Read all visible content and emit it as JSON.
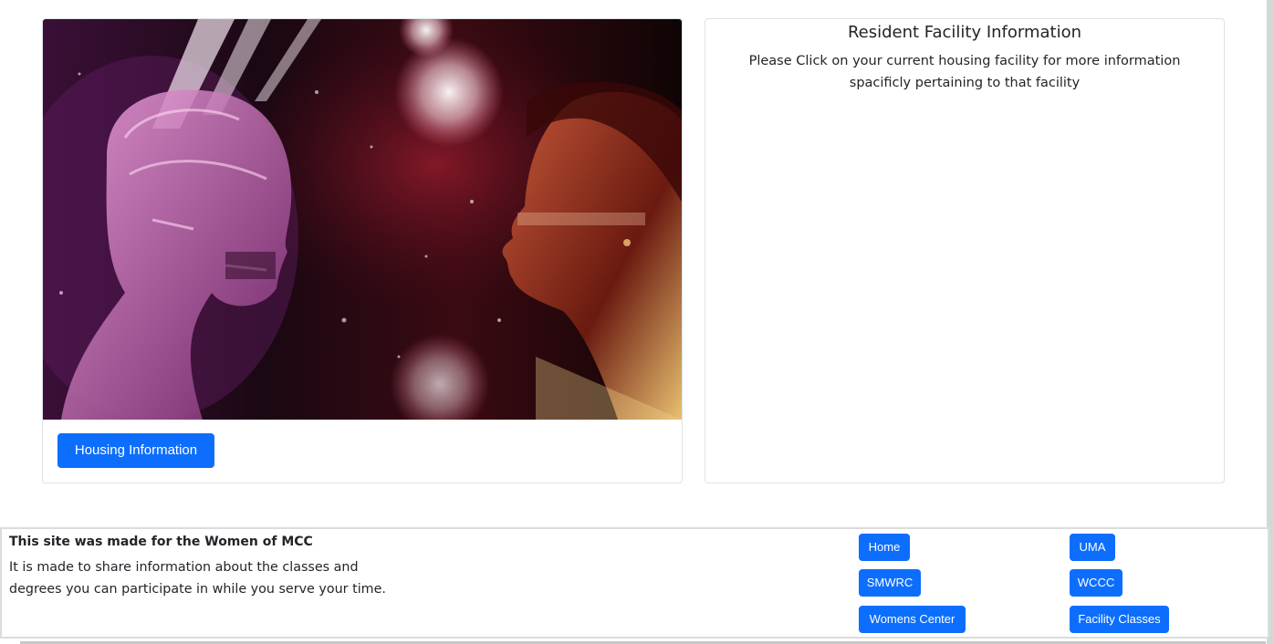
{
  "hero_image": {
    "alt": ""
  },
  "buttons": {
    "housing": "Housing Information"
  },
  "facility": {
    "title": "Resident Facility Information",
    "text": "Please Click on your current housing facility for more information spacificly pertaining to that facility"
  },
  "footer": {
    "title": "This site was made for the Women of MCC",
    "text": "It is made to share information about the classes and degrees you can participate in while you serve your time.",
    "links": {
      "home": "Home",
      "uma": "UMA",
      "smwrc": "SMWRC",
      "wccc": "WCCC",
      "womens_center": "Womens Center",
      "facility_classes": "Facility Classes"
    }
  },
  "colors": {
    "primary": "#0d6efd",
    "border": "#dee2e6"
  }
}
